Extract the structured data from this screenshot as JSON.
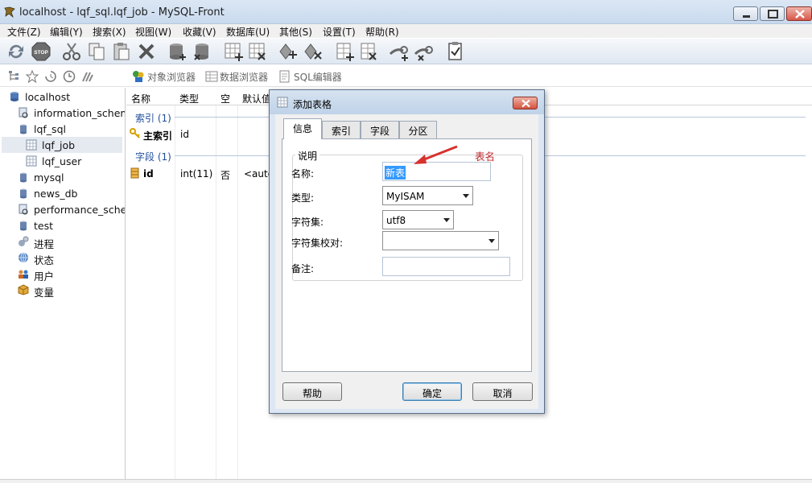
{
  "window": {
    "title": "localhost - lqf_sql.lqf_job - MySQL-Front"
  },
  "menu": [
    "文件(Z)",
    "编辑(Y)",
    "搜索(X)",
    "视图(W)",
    "收藏(V)",
    "数据库(U)",
    "其他(S)",
    "设置(T)",
    "帮助(R)"
  ],
  "subbar": {
    "object_browser": "对象浏览器",
    "data_browser": "数据浏览器",
    "sql_editor": "SQL编辑器"
  },
  "tree": [
    "localhost",
    "information_schem",
    "lqf_sql",
    "lqf_job",
    "lqf_user",
    "mysql",
    "news_db",
    "performance_scher",
    "test",
    "进程",
    "状态",
    "用户",
    "变量"
  ],
  "grid": {
    "headers": {
      "name": "名称",
      "type": "类型",
      "null": "空",
      "default": "默认值"
    },
    "index_section": "索引 (1)",
    "index_row": {
      "name": "主索引",
      "value": "id"
    },
    "field_section": "字段 (1)",
    "field_row": {
      "name": "id",
      "type": "int(11)",
      "null": "否",
      "default": "<auto"
    }
  },
  "dialog": {
    "title": "添加表格",
    "tabs": [
      "信息",
      "索引",
      "字段",
      "分区"
    ],
    "group_label": "说明",
    "name_label": "名称:",
    "name_value": "新表",
    "type_label": "类型:",
    "type_value": "MyISAM",
    "charset_label": "字符集:",
    "charset_value": "utf8",
    "collation_label": "字符集校对:",
    "collation_value": "",
    "comment_label": "备注:",
    "comment_value": "",
    "help_button": "帮助",
    "ok_button": "确定",
    "cancel_button": "取消"
  },
  "annotation": {
    "text": "表名",
    "color": "#c0282a"
  }
}
